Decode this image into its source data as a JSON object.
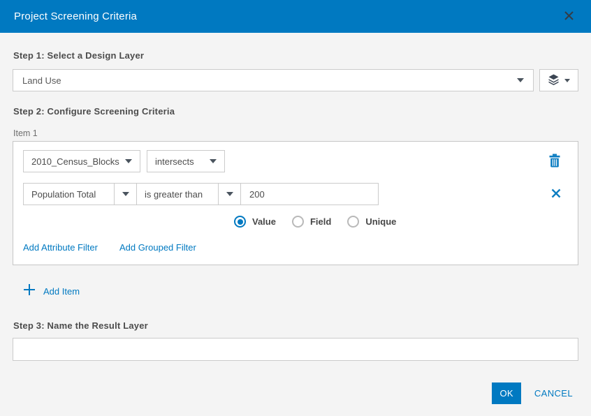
{
  "dialog": {
    "title": "Project Screening Criteria"
  },
  "colors": {
    "header_bg": "#0079c1",
    "accent": "#0079c1",
    "body_bg": "#f4f4f4",
    "border": "#cbcbcb",
    "label_text": "#4c4c4c"
  },
  "step1": {
    "label": "Step 1: Select a Design Layer",
    "layer_select": {
      "value": "Land Use"
    },
    "layers_button": {
      "icon": "layers-icon"
    }
  },
  "step2": {
    "label": "Step 2: Configure Screening Criteria",
    "item_label": "Item 1",
    "criteria": {
      "layer_dropdown": "2010_Census_Blocks",
      "spatial_operator_dropdown": "intersects"
    },
    "attribute_filter": {
      "field": "Population Total",
      "operator": "is greater than",
      "value": "200"
    },
    "radio_options": [
      {
        "label": "Value",
        "selected": true
      },
      {
        "label": "Field",
        "selected": false
      },
      {
        "label": "Unique",
        "selected": false
      }
    ],
    "links": {
      "add_attribute_filter": "Add Attribute Filter",
      "add_grouped_filter": "Add Grouped Filter"
    },
    "add_item_label": "Add Item"
  },
  "step3": {
    "label": "Step 3: Name the Result Layer",
    "input_value": ""
  },
  "footer": {
    "ok_label": "OK",
    "cancel_label": "CANCEL"
  }
}
